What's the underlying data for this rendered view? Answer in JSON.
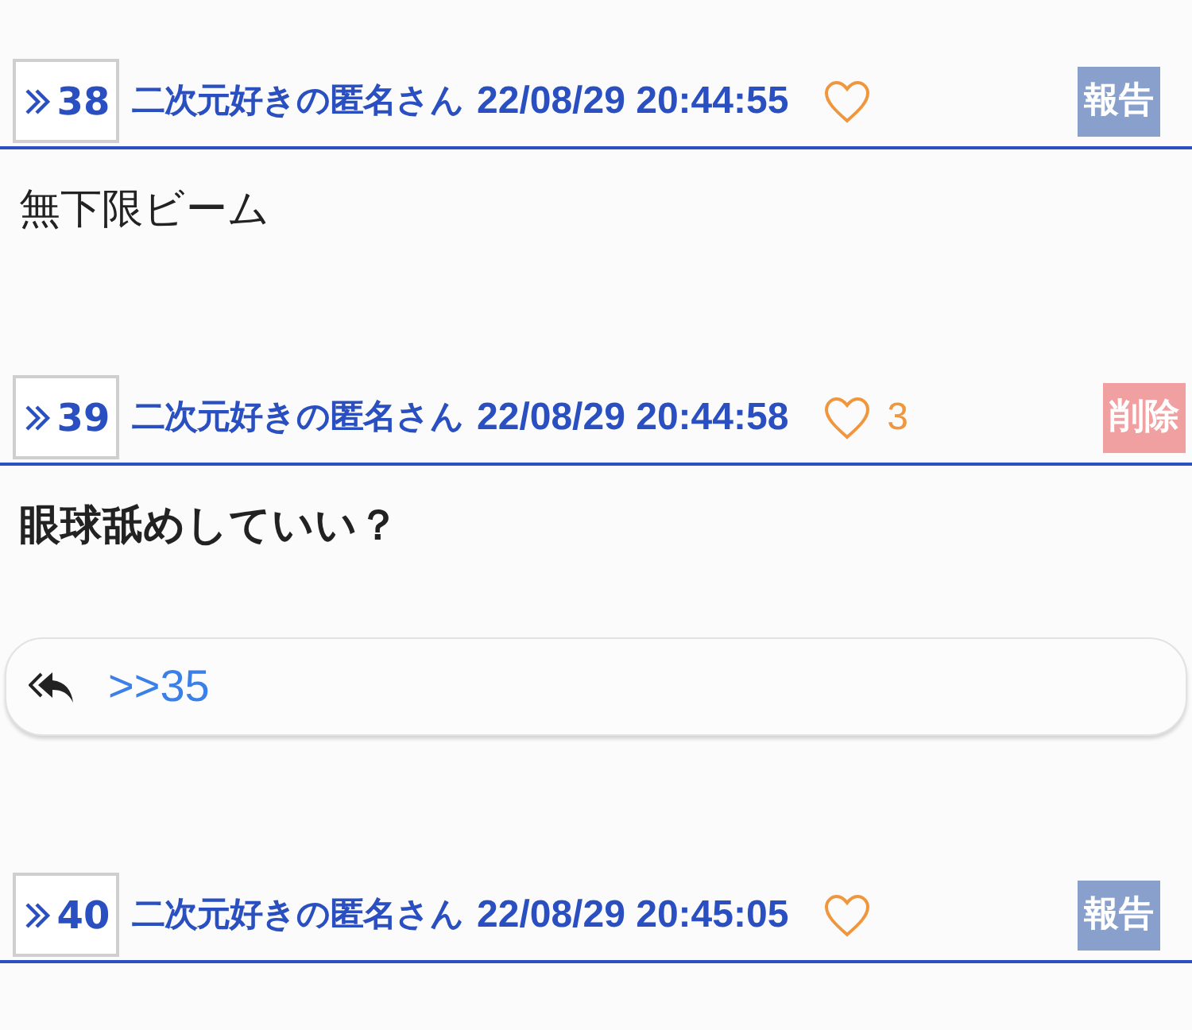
{
  "posts": [
    {
      "number": "38",
      "author": "二次元好きの匿名さん",
      "datetime": "22/08/29 20:44:55",
      "liked": false,
      "action": {
        "kind": "report",
        "label": "報告"
      },
      "body": "無下限ビーム",
      "bold": false
    },
    {
      "number": "39",
      "author": "二次元好きの匿名さん",
      "datetime": "22/08/29 20:44:58",
      "liked": false,
      "likes": "3",
      "action": {
        "kind": "delete",
        "label": "削除"
      },
      "body": "眼球舐めしていい？",
      "bold": true,
      "replies": [
        ">>35"
      ]
    },
    {
      "number": "40",
      "author": "二次元好きの匿名さん",
      "datetime": "22/08/29 20:45:05",
      "liked": false,
      "action": {
        "kind": "report",
        "label": "報告"
      }
    }
  ]
}
